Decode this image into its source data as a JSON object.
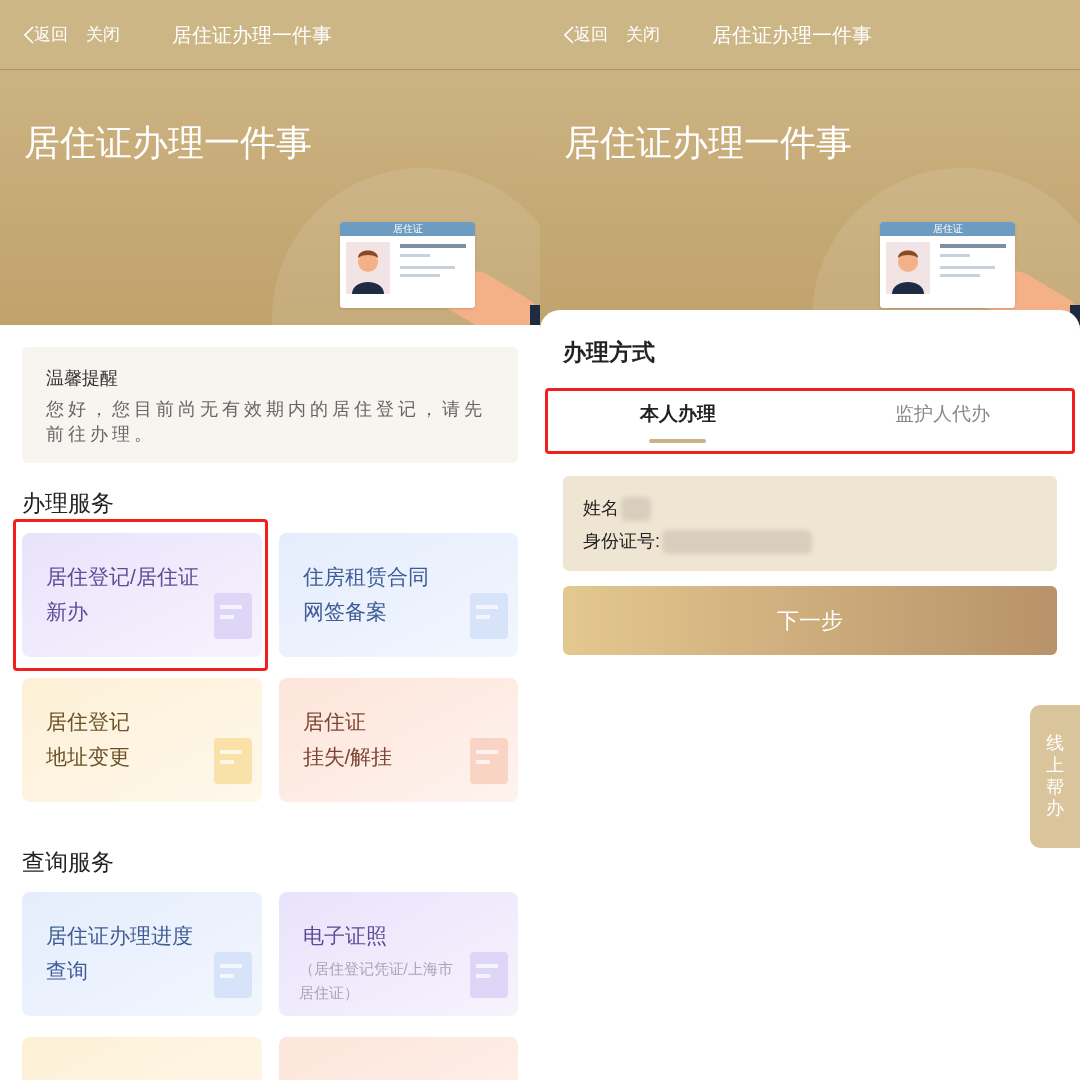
{
  "left_screen": {
    "nav": {
      "back": "返回",
      "close": "关闭",
      "title": "居住证办理一件事"
    },
    "banner": {
      "title": "居住证办理一件事",
      "card_label": "居住证"
    },
    "notice": {
      "title": "温馨提醒",
      "text": "您好，您目前尚无有效期内的居住登记，请先前往办理。"
    },
    "sections": [
      {
        "title": "办理服务",
        "cards": [
          {
            "title_lines": [
              "居住登记/居住证",
              "新办"
            ],
            "kind": "purple",
            "highlighted": true
          },
          {
            "title_lines": [
              "住房租赁合同",
              "网签备案"
            ],
            "kind": "blue",
            "highlighted": false
          },
          {
            "title_lines": [
              "居住登记",
              "地址变更"
            ],
            "kind": "yellow",
            "highlighted": false
          },
          {
            "title_lines": [
              "居住证",
              "挂失/解挂"
            ],
            "kind": "peach",
            "highlighted": false
          }
        ]
      },
      {
        "title": "查询服务",
        "cards": [
          {
            "title_lines": [
              "居住证办理进度",
              "查询"
            ],
            "kind": "blue",
            "highlighted": false
          },
          {
            "title_lines": [
              "电子证照"
            ],
            "subtitle": "（居住登记凭证/上海市居住证）",
            "kind": "purple",
            "highlighted": false
          },
          {
            "kind": "yellow",
            "highlighted": false
          },
          {
            "kind": "peach",
            "highlighted": false
          }
        ]
      }
    ]
  },
  "right_screen": {
    "nav": {
      "back": "返回",
      "close": "关闭",
      "title": "居住证办理一件事"
    },
    "banner": {
      "title": "居住证办理一件事",
      "card_label": "居住证"
    },
    "sheet": {
      "title": "办理方式",
      "tabs_highlighted": true,
      "tabs": [
        {
          "label": "本人办理",
          "selected": true
        },
        {
          "label": "监护人代办",
          "selected": false
        }
      ],
      "fields": [
        {
          "label": "姓名"
        },
        {
          "label": "身份证号:"
        }
      ],
      "next_button": "下一步"
    },
    "help_tab": "线上帮办"
  }
}
